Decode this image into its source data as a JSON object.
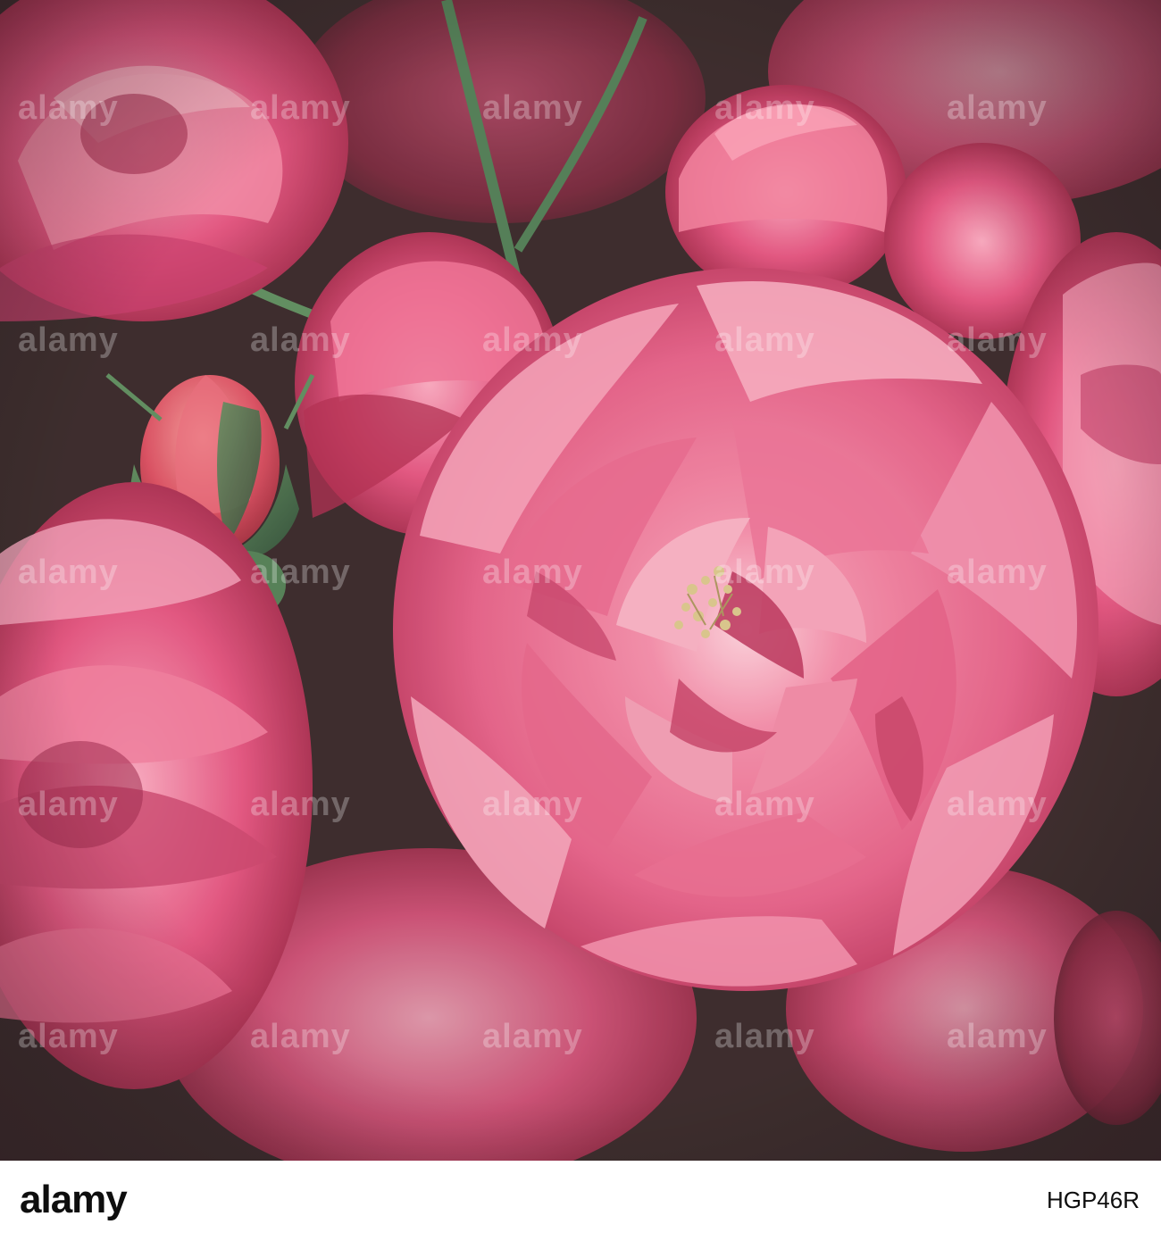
{
  "photo": {
    "subject": "pink-roses",
    "palette": {
      "petal_light": "#f08aa8",
      "petal_mid": "#e0507c",
      "petal_deep": "#b8284e",
      "shadow": "#5a1c2c",
      "leaf": "#3f6a46",
      "leaf_dark": "#22372a",
      "stamen": "#d8c48a"
    }
  },
  "watermark": {
    "text": "alamy"
  },
  "footer": {
    "logo_text": "alamy",
    "image_id": "HGP46R"
  }
}
